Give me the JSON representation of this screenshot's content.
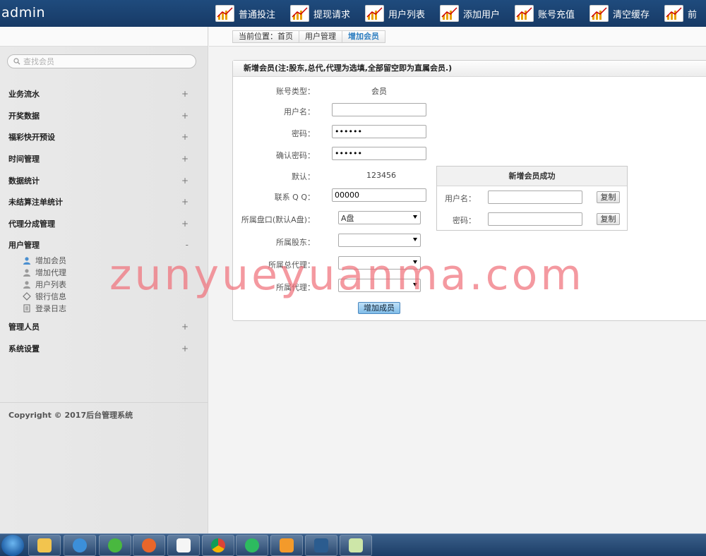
{
  "brand": "admin",
  "topnav": [
    {
      "label": "普通投注",
      "icon": "chart-icon"
    },
    {
      "label": "提现请求",
      "icon": "chart-icon"
    },
    {
      "label": "用户列表",
      "icon": "chart-icon"
    },
    {
      "label": "添加用户",
      "icon": "chart-icon"
    },
    {
      "label": "账号充值",
      "icon": "chart-icon"
    },
    {
      "label": "清空缓存",
      "icon": "chart-icon"
    },
    {
      "label": "前",
      "icon": "chart-icon"
    }
  ],
  "sidebar": {
    "search_placeholder": "查找会员",
    "menu": [
      {
        "label": "业务流水",
        "sign": "+"
      },
      {
        "label": "开奖数据",
        "sign": "+"
      },
      {
        "label": "福彩快开预设",
        "sign": "+"
      },
      {
        "label": "时间管理",
        "sign": "+"
      },
      {
        "label": "数据统计",
        "sign": "+"
      },
      {
        "label": "未结算注单统计",
        "sign": "+"
      },
      {
        "label": "代理分成管理",
        "sign": "+"
      },
      {
        "label": "用户管理",
        "sign": "-"
      },
      {
        "label": "管理人员",
        "sign": "+"
      },
      {
        "label": "系统设置",
        "sign": "+"
      }
    ],
    "submenu": [
      {
        "label": "增加会员",
        "icon": "user-add-icon"
      },
      {
        "label": "增加代理",
        "icon": "user-icon"
      },
      {
        "label": "用户列表",
        "icon": "user-icon"
      },
      {
        "label": "银行信息",
        "icon": "diamond-icon"
      },
      {
        "label": "登录日志",
        "icon": "document-icon"
      }
    ],
    "copyright": "Copyright © 2017后台管理系统"
  },
  "breadcrumb": {
    "prefix": "当前位置：首页",
    "level1": "用户管理",
    "current": "增加会员"
  },
  "form": {
    "title": "新增会员(注:股东,总代,代理为选填,全部留空即为直属会员.)",
    "account_type_label": "账号类型：",
    "account_type_value": "会员",
    "username_label": "用户名：",
    "username_value": "",
    "password_label": "密码：",
    "password_value": "123456",
    "confirm_label": "确认密码：",
    "confirm_value": "123456",
    "default_label": "默认：",
    "default_value": "123456",
    "qq_label": "联系 Q Q：",
    "qq_value": "00000",
    "plate_label": "所属盘口(默认A盘)：",
    "plate_value": "A盘",
    "shareholder_label": "所属股东：",
    "shareholder_value": "",
    "general_agent_label": "所属总代理：",
    "general_agent_value": "",
    "agent_label": "所属代理：",
    "agent_value": "",
    "submit_label": "增加成员"
  },
  "success": {
    "title": "新增会员成功",
    "username_label": "用户名：",
    "password_label": "密码：",
    "copy_label": "复制"
  },
  "watermark": "zunyueyuanma.com",
  "taskbar": [
    "explorer",
    "ie",
    "browser-360",
    "firefox",
    "baidu-netdisk",
    "chrome",
    "video-player",
    "uc-browser",
    "photoshop",
    "notepad"
  ]
}
